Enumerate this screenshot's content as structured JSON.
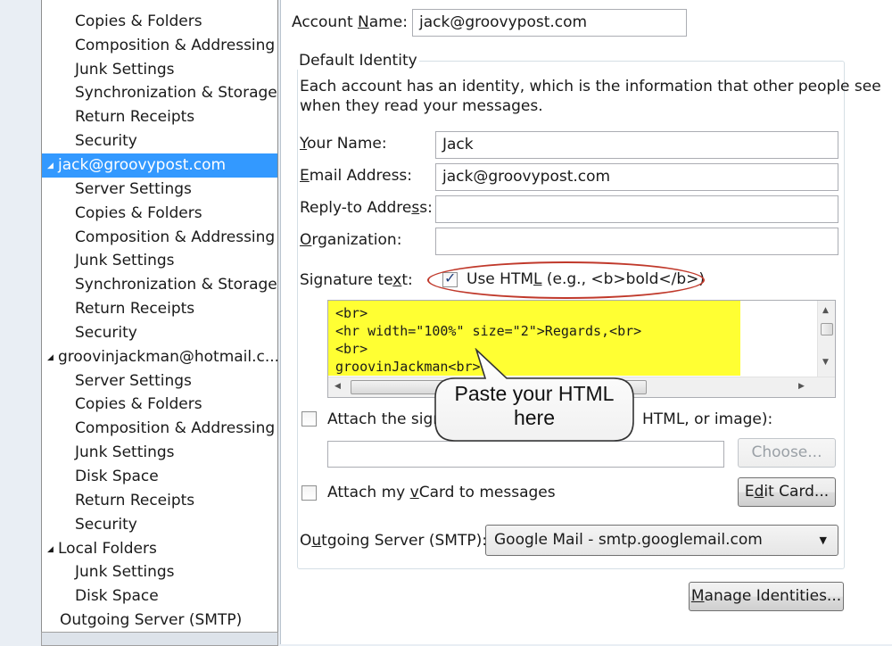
{
  "sidebar": {
    "items": [
      {
        "label": "",
        "kind": "child",
        "cut": true
      },
      {
        "label": "Copies & Folders",
        "kind": "child"
      },
      {
        "label": "Composition & Addressing",
        "kind": "child"
      },
      {
        "label": "Junk Settings",
        "kind": "child"
      },
      {
        "label": "Synchronization & Storage",
        "kind": "child"
      },
      {
        "label": "Return Receipts",
        "kind": "child"
      },
      {
        "label": "Security",
        "kind": "child"
      },
      {
        "label": "jack@groovypost.com",
        "kind": "parent",
        "selected": true
      },
      {
        "label": "Server Settings",
        "kind": "child"
      },
      {
        "label": "Copies & Folders",
        "kind": "child"
      },
      {
        "label": "Composition & Addressing",
        "kind": "child"
      },
      {
        "label": "Junk Settings",
        "kind": "child"
      },
      {
        "label": "Synchronization & Storage",
        "kind": "child"
      },
      {
        "label": "Return Receipts",
        "kind": "child"
      },
      {
        "label": "Security",
        "kind": "child"
      },
      {
        "label": "groovinjackman@hotmail.c...",
        "kind": "parent"
      },
      {
        "label": "Server Settings",
        "kind": "child"
      },
      {
        "label": "Copies & Folders",
        "kind": "child"
      },
      {
        "label": "Composition & Addressing",
        "kind": "child"
      },
      {
        "label": "Junk Settings",
        "kind": "child"
      },
      {
        "label": "Disk Space",
        "kind": "child"
      },
      {
        "label": "Return Receipts",
        "kind": "child"
      },
      {
        "label": "Security",
        "kind": "child"
      },
      {
        "label": "Local Folders",
        "kind": "parent"
      },
      {
        "label": "Junk Settings",
        "kind": "child"
      },
      {
        "label": "Disk Space",
        "kind": "child"
      },
      {
        "label": "Outgoing Server (SMTP)",
        "kind": "top"
      }
    ]
  },
  "account": {
    "name_label_pre": "Account ",
    "name_label_key": "N",
    "name_label_post": "ame:",
    "name_value": "jack@groovypost.com"
  },
  "identity": {
    "group_title": "Default Identity",
    "description_line1": "Each account has an identity, which is the information that other people see",
    "description_line2": "when they read your messages.",
    "your_name_key": "Y",
    "your_name_rest": "our Name:",
    "your_name_value": "Jack",
    "email_key": "E",
    "email_rest": "mail Address:",
    "email_value": "jack@groovypost.com",
    "replyto_pre": "Reply-to Addre",
    "replyto_key": "s",
    "replyto_post": "s:",
    "replyto_value": "",
    "org_key": "O",
    "org_rest": "rganization:",
    "org_value": ""
  },
  "signature": {
    "label_pre": "Signature te",
    "label_key": "x",
    "label_post": "t:",
    "use_html_pre": "Use HTM",
    "use_html_key": "L",
    "use_html_post": " (e.g., <b>bold</b>)",
    "use_html_checked": true,
    "text": "<br>\n<hr width=\"100%\" size=\"2\">Regards,<br>\n<br>\ngroovinJackman<br>"
  },
  "callout": {
    "line1": "Paste your HTML",
    "line2": "here"
  },
  "attach_sig": {
    "label_start": "Attach the sign",
    "label_end": "HTML, or image):",
    "checked": false,
    "path_value": "",
    "choose_label": "Choose..."
  },
  "vcard": {
    "label_pre": "Attach my ",
    "label_key": "v",
    "label_post": "Card to messages",
    "checked": false,
    "edit_card_pre": "E",
    "edit_card_key": "d",
    "edit_card_post": "it Card..."
  },
  "smtp": {
    "label_pre": "O",
    "label_key": "u",
    "label_post": "tgoing Server (SMTP):",
    "selected": "Google Mail - smtp.googlemail.com"
  },
  "manage": {
    "label_key": "M",
    "label_rest": "anage Identities..."
  },
  "colors": {
    "selection": "#3399ff",
    "highlight_yellow": "#ffff33",
    "ellipse_red": "#c0392b"
  }
}
